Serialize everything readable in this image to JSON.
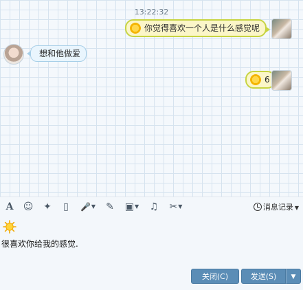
{
  "chat": {
    "timestamp": "13:22:32",
    "messages": [
      {
        "sender": "me",
        "text": "你觉得喜欢一个人是什么感觉呢",
        "emoji": "sun-emoji"
      },
      {
        "sender": "her",
        "text": "想和他做爱"
      },
      {
        "sender": "me",
        "text": "6",
        "emoji": "sun-emoji"
      }
    ]
  },
  "toolbar": {
    "font_icon": "A",
    "emoji_icon": "☺",
    "poke_icon": "✦",
    "screen_icon": "▯",
    "voice_icon": "🎤",
    "edit_icon": "✎",
    "image_icon": "▣",
    "music_icon": "♫",
    "screenshot_icon": "✂",
    "history_label": "消息记录"
  },
  "input": {
    "emoji": "sun-emoji",
    "text": "很喜欢你给我的感觉."
  },
  "footer": {
    "close_label": "关闭(C)",
    "send_label": "发送(S)"
  },
  "colors": {
    "my_bubble_border": "#c7d442",
    "my_bubble_bg": "#fbf6c8",
    "her_bubble_border": "#a7cfe8",
    "button_bg": "#5b8db6"
  }
}
